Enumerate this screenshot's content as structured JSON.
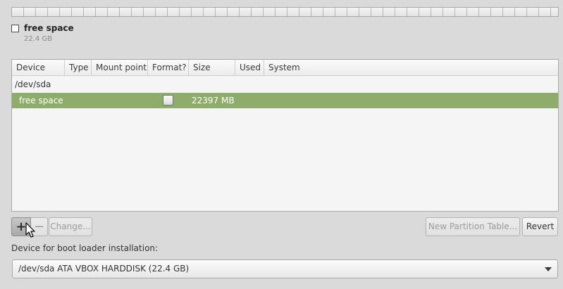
{
  "legend": {
    "name": "free space",
    "size": "22.4 GB"
  },
  "table": {
    "columns": [
      "Device",
      "Type",
      "Mount point",
      "Format?",
      "Size",
      "Used",
      "System"
    ],
    "rows": [
      {
        "device": "/dev/sda"
      },
      {
        "device": "free space",
        "format_checked": false,
        "size": "22397 MB"
      }
    ]
  },
  "toolbar": {
    "add_label": "+",
    "remove_label": "−",
    "change_label": "Change...",
    "new_table_label": "New Partition Table...",
    "revert_label": "Revert"
  },
  "bootloader": {
    "label": "Device for boot loader installation:",
    "selected": "/dev/sda  ATA VBOX HARDDISK (22.4 GB)"
  },
  "colors": {
    "selected_row": "#8fad6a",
    "background": "#dadada"
  }
}
